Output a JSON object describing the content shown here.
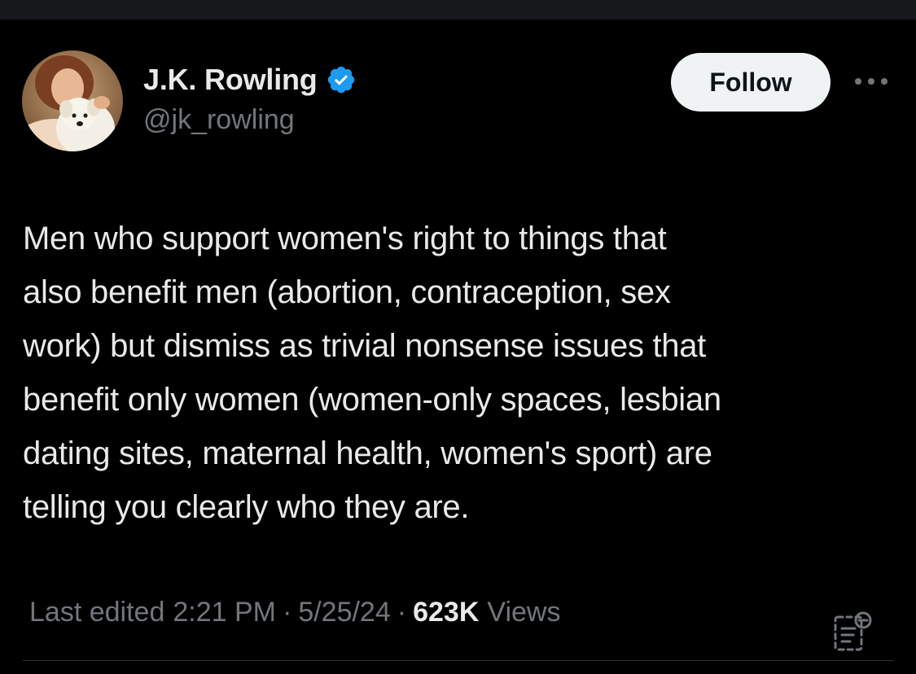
{
  "author": {
    "display_name": "J.K. Rowling",
    "handle": "@jk_rowling",
    "verified": true,
    "verified_color": "#1d9bf0"
  },
  "actions": {
    "follow_label": "Follow",
    "more_icon": "more-horizontal-icon"
  },
  "tweet": {
    "text": "Men who support women's right to things that\nalso benefit men (abortion, contraception, sex\nwork) but dismiss as trivial nonsense issues that\nbenefit only women (women-only spaces, lesbian\ndating sites, maternal health, women's sport) are\ntelling you clearly who they are."
  },
  "meta": {
    "edited_prefix": "Last edited",
    "time": "2:21 PM",
    "separator": "·",
    "date": "5/25/24",
    "views_count": "623K",
    "views_label": "Views"
  },
  "icons": {
    "edit_history": "edit-history-icon"
  },
  "colors": {
    "background": "#000000",
    "text_primary": "#e7e9ea",
    "text_secondary": "#71767b",
    "follow_bg": "#eff3f4",
    "divider": "#2f3336"
  }
}
